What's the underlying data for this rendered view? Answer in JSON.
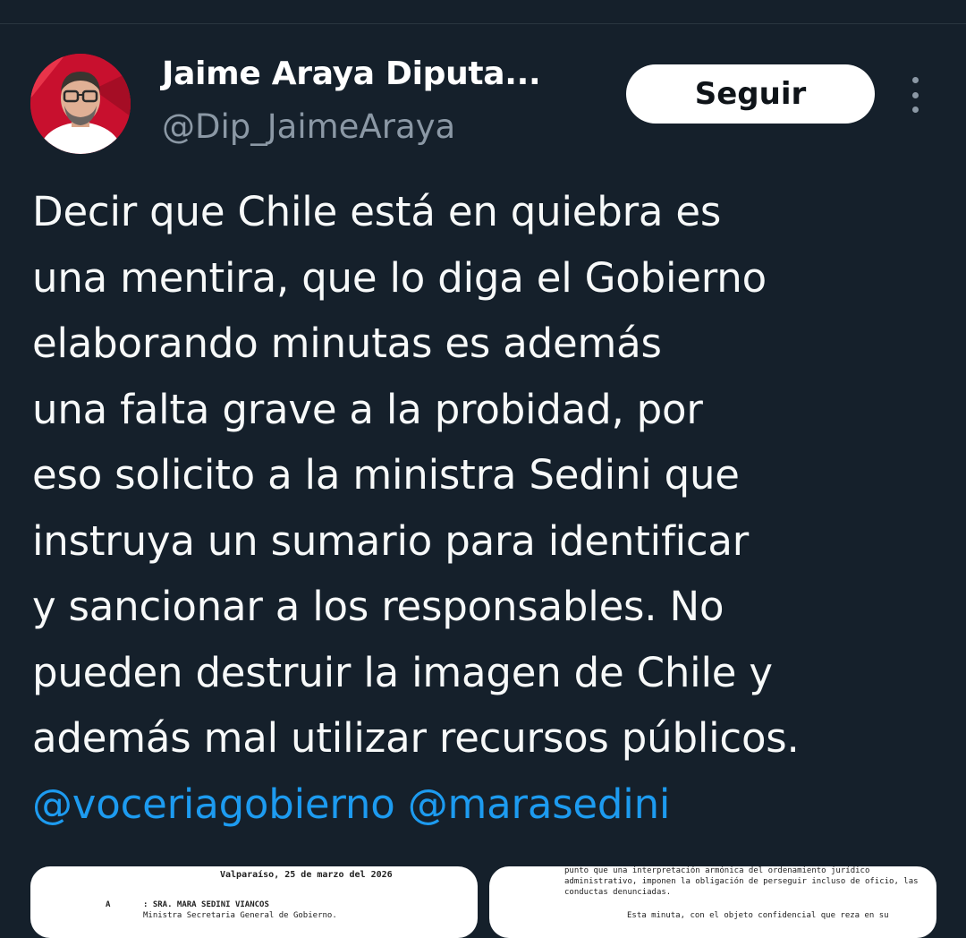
{
  "author": {
    "display_name": "Jaime Araya Diputa...",
    "handle": "@Dip_JaimeAraya",
    "avatar_icon": "profile-photo"
  },
  "actions": {
    "follow_label": "Seguir",
    "more_icon": "more-vertical-icon"
  },
  "tweet": {
    "lines": [
      "Decir que Chile está en quiebra es",
      "una mentira, que lo diga el Gobierno",
      "elaborando minutas es además",
      "una falta grave a la probidad, por",
      "eso solicito a la ministra Sedini que",
      "instruya un sumario para identificar",
      "y sancionar a los responsables. No",
      "pueden destruir la imagen de Chile y",
      "además mal utilizar recursos públicos."
    ],
    "mentions": [
      "@voceriagobierno",
      "@marasedini"
    ]
  },
  "attachments": {
    "left": {
      "date_line": "Valparaíso, 25 de marzo del 2026",
      "to_label": "A",
      "to_name": ": SRA. MARA SEDINI VIANCOS",
      "to_title": "Ministra Secretaria General de Gobierno."
    },
    "right": {
      "lines": [
        "punto que una interpretación armónica del ordenamiento jurídico",
        "administrativo, imponen la obligación de perseguir incluso de oficio, las",
        "conductas denunciadas.",
        "Esta minuta, con el objeto confidencial que reza en su"
      ]
    }
  },
  "colors": {
    "background": "#15202b",
    "text": "#f7f9f9",
    "secondary": "#8b98a5",
    "mention": "#1d9bf0",
    "button_bg": "#ffffff"
  }
}
